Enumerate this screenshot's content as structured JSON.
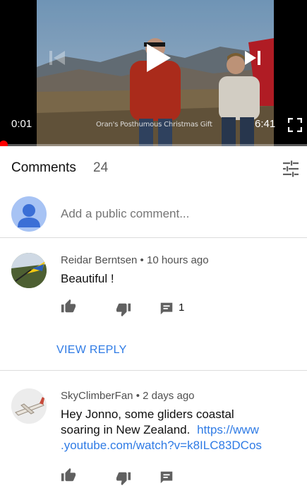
{
  "player": {
    "current_time": "0:01",
    "total_time": "6:41",
    "caption_text": "Oran's Posthumous Christmas Gift",
    "progress_fraction": 0.0025,
    "icons": {
      "play": "play-icon",
      "previous": "skip-previous-icon",
      "next": "skip-next-icon",
      "fullscreen": "fullscreen-icon"
    }
  },
  "comments_section": {
    "title": "Comments",
    "count": "24",
    "sort_icon": "sort-filter-icon",
    "add_comment_placeholder": "Add a public comment...",
    "comments": [
      {
        "author": "Reidar Berntsen",
        "time": "10 hours ago",
        "meta": "Reidar Berntsen • 10 hours ago",
        "text": "Beautiful !",
        "reply_count": "1",
        "view_reply_label": "VIEW REPLY"
      },
      {
        "author": "SkyClimberFan",
        "time": "2 days ago",
        "meta": "SkyClimberFan • 2 days ago",
        "text_line1": "Hey Jonno, some gliders coastal",
        "text_line2_prefix": "soaring in New Zealand.",
        "link_part1": "https://www",
        "link_part2": ".youtube.com/watch?v=k8ILC83DCos"
      }
    ]
  },
  "colors": {
    "link_blue": "#2f7be5",
    "progress_red": "#ff0000",
    "avatar_blue": "#a7c3f4",
    "avatar_figure": "#3b6fd6"
  }
}
